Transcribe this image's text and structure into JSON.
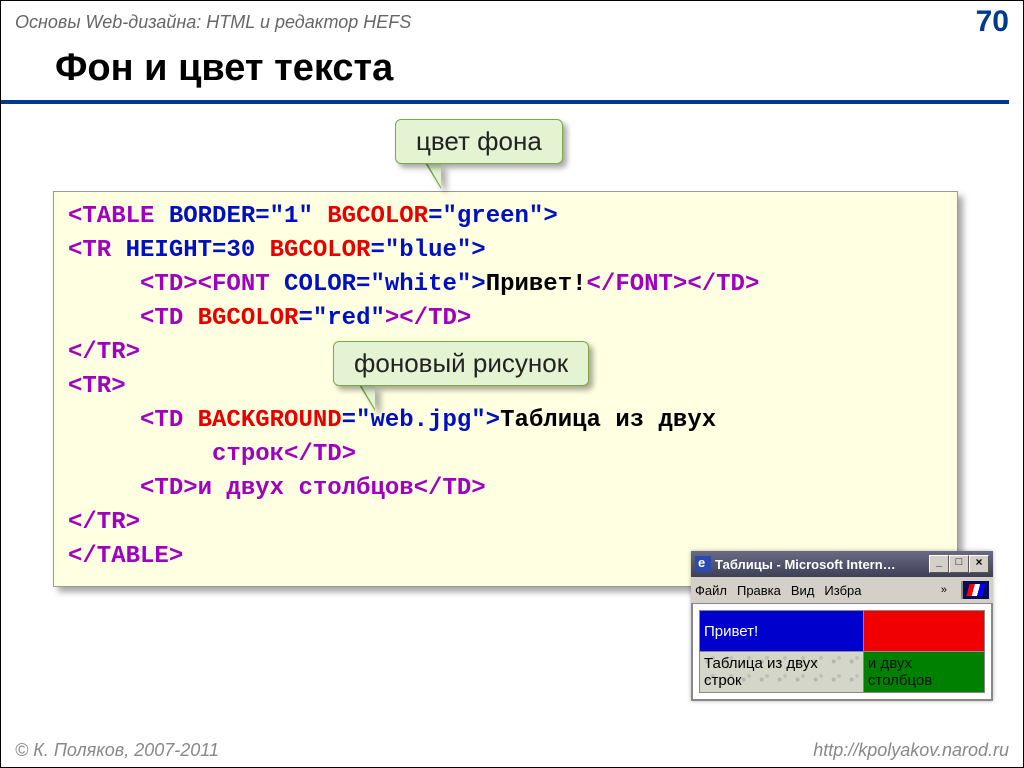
{
  "header": {
    "subtitle": "Основы Web-дизайна: HTML и редактор HEFS",
    "page_number": "70"
  },
  "title": "Фон и цвет текста",
  "callouts": {
    "bg_color": "цвет фона",
    "bg_image": "фоновый рисунок"
  },
  "code": {
    "l1": {
      "a": "<TABLE ",
      "b": "BORDER=\"1\"",
      "c": " ",
      "d": "BGCOLOR",
      "e": "=\"green\">"
    },
    "l2": {
      "a": "<TR ",
      "b": "HEIGHT=30 ",
      "c": "BGCOLOR",
      "d": "=\"blue\">"
    },
    "l3": {
      "a": "     <TD>",
      "b": "<FONT ",
      "c": "COLOR=\"white\">",
      "d": "Привет!",
      "e": "</FONT>",
      "f": "</TD>"
    },
    "l4": {
      "a": "     <TD ",
      "b": "BGCOLOR",
      "c": "=\"red\"",
      "d": "></TD>"
    },
    "l5": "</TR>",
    "l6": "<TR>",
    "l7": {
      "a": "     <TD ",
      "b": "BACKGROUND",
      "c": "=\"web.jpg\">",
      "d": "Таблица из двух"
    },
    "l8": "          строк</TD>",
    "l9": "     <TD>и двух столбцов</TD>",
    "l10": "</TR>",
    "l11": "</TABLE>"
  },
  "browser": {
    "title": "Таблицы - Microsoft Intern…",
    "menu": {
      "file": "Файл",
      "edit": "Правка",
      "view": "Вид",
      "fav": "Избра",
      "more": "»"
    },
    "table": {
      "r1c1": "Привет!",
      "r1c2": "",
      "r2c1": "Таблица из двух строк",
      "r2c2": "и двух столбцов"
    }
  },
  "footer": {
    "copyright": "© К. Поляков, 2007-2011",
    "url": "http://kpolyakov.narod.ru"
  }
}
